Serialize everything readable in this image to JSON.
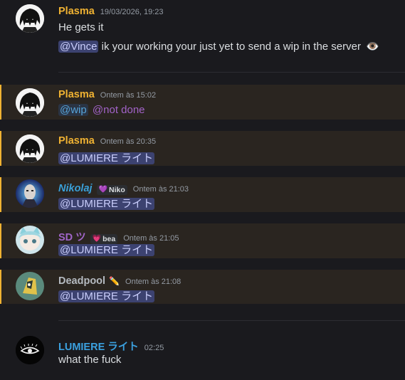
{
  "messages": [
    {
      "author": "Plasma",
      "timestamp": "19/03/2026, 19:23",
      "lines": [
        "He gets it",
        "ik your working your just yet to send a wip in the server"
      ],
      "mention": "@Vince",
      "emoji": "👁️"
    },
    {
      "author": "Plasma",
      "timestamp": "Ontem às 15:02",
      "mentions": [
        "@wip",
        "@not done"
      ]
    },
    {
      "author": "Plasma",
      "timestamp": "Ontem às 20:35",
      "mention": "@LUMIERE ライト"
    },
    {
      "author": "Nikolaj",
      "tag": "Niko",
      "tag_icon": "💜",
      "timestamp": "Ontem às 21:03",
      "mention": "@LUMIERE ライト"
    },
    {
      "author": "SD ツ",
      "tag": "bea",
      "tag_icon": "💗",
      "timestamp": "Ontem às 21:05",
      "mention": "@LUMIERE ライト"
    },
    {
      "author": "Deadpool",
      "author_emoji": "✏️",
      "timestamp": "Ontem às 21:08",
      "mention": "@LUMIERE ライト"
    },
    {
      "author": "LUMIERE ライト",
      "timestamp": "02:25",
      "text": "what the fuck"
    }
  ],
  "colors": {
    "plasma": "#f0b232",
    "nikolaj": "#3aa0d8",
    "sd": "#a065c8",
    "deadpool": "#b5bac1",
    "lumiere": "#3ba1e0",
    "highlight_bar": "#f0b232",
    "highlight_bg": "#2a2520"
  },
  "icons": [
    "plasma-avatar",
    "nikolaj-avatar",
    "sd-avatar",
    "deadpool-avatar",
    "lumiere-avatar",
    "eye-emoji",
    "pencil-emoji"
  ]
}
